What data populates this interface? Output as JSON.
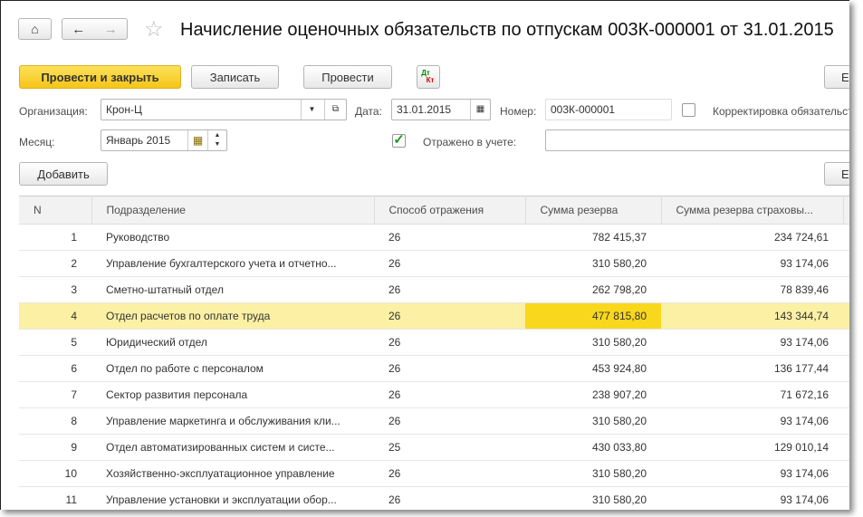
{
  "header": {
    "title": "Начисление оценочных обязательств по отпускам 003К-000001 от 31.01.2015",
    "home_icon": "home-icon",
    "back_icon": "arrow-left-icon",
    "forward_icon": "arrow-right-icon",
    "star_icon": "star-icon"
  },
  "toolbar": {
    "post_close": "Провести и закрыть",
    "save": "Записать",
    "post": "Провести",
    "dtkt_dt": "Дт",
    "dtkt_kt": "Кт",
    "more": "Еще"
  },
  "form": {
    "org_label": "Организация:",
    "org_value": "Крон-Ц",
    "date_label": "Дата:",
    "date_value": "31.01.2015",
    "number_label": "Номер:",
    "number_value": "003К-000001",
    "correction_label": "Корректировка обязательств",
    "month_label": "Месяц:",
    "month_value": "Январь 2015",
    "reflected_label": "Отражено в учете:",
    "reflected_value": "",
    "reflected_checked": true,
    "correction_checked": false
  },
  "table_toolbar": {
    "add": "Добавить",
    "more": "Еще"
  },
  "table": {
    "columns": [
      "N",
      "Подразделение",
      "Способ отражения",
      "Сумма резерва",
      "Сумма резерва страховы..."
    ],
    "rows": [
      [
        "1",
        "Руководство",
        "26",
        "782 415,37",
        "234 724,61"
      ],
      [
        "2",
        "Управление бухгалтерского учета и отчетно...",
        "26",
        "310 580,20",
        "93 174,06"
      ],
      [
        "3",
        "Сметно-штатный отдел",
        "26",
        "262 798,20",
        "78 839,46"
      ],
      [
        "4",
        "Отдел расчетов по оплате труда",
        "26",
        "477 815,80",
        "143 344,74"
      ],
      [
        "5",
        "Юридический отдел",
        "26",
        "310 580,20",
        "93 174,06"
      ],
      [
        "6",
        "Отдел по работе с персоналом",
        "26",
        "453 924,80",
        "136 177,44"
      ],
      [
        "7",
        "Сектор развития персонала",
        "26",
        "238 907,20",
        "71 672,16"
      ],
      [
        "8",
        "Управление маркетинга и обслуживания кли...",
        "26",
        "310 580,20",
        "93 174,06"
      ],
      [
        "9",
        "Отдел автоматизированных систем и систе...",
        "25",
        "430 033,80",
        "129 010,14"
      ],
      [
        "10",
        "Хозяйственно-эксплуатационное управление",
        "26",
        "310 580,20",
        "93 174,06"
      ],
      [
        "11",
        "Управление установки и эксплуатации обор...",
        "26",
        "310 580,20",
        "93 174,06"
      ]
    ],
    "selected_row": 3
  },
  "colors": {
    "accent": "#f5c518",
    "selected_row": "#fbf0a4",
    "selected_cell": "#f9d71c"
  }
}
